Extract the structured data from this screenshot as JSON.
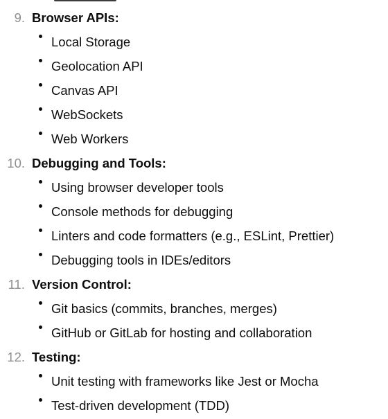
{
  "sections": [
    {
      "number": "9.",
      "title": "Browser APIs:",
      "items": [
        "Local Storage",
        "Geolocation API",
        "Canvas API",
        "WebSockets",
        "Web Workers"
      ]
    },
    {
      "number": "10.",
      "title": "Debugging and Tools:",
      "items": [
        "Using browser developer tools",
        "Console methods for debugging",
        "Linters and code formatters (e.g., ESLint, Prettier)",
        "Debugging tools in IDEs/editors"
      ]
    },
    {
      "number": "11.",
      "title": "Version Control:",
      "items": [
        "Git basics (commits, branches, merges)",
        "GitHub or GitLab for hosting and collaboration"
      ]
    },
    {
      "number": "12.",
      "title": "Testing:",
      "items": [
        "Unit testing with frameworks like Jest or Mocha",
        "Test-driven development (TDD)"
      ]
    }
  ]
}
